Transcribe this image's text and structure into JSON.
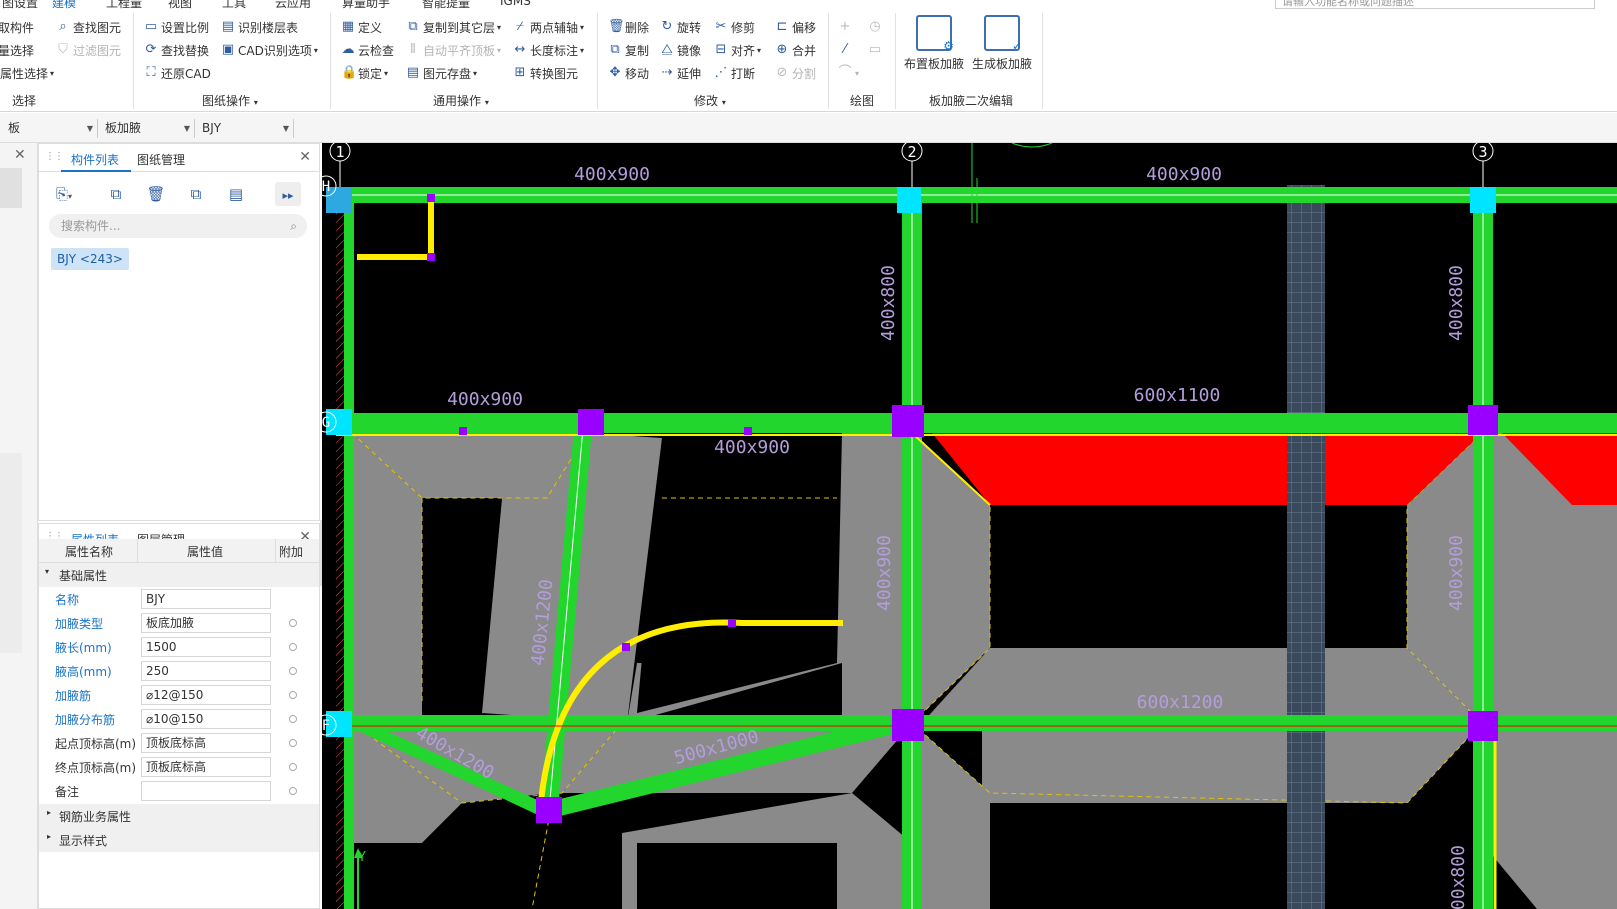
{
  "menubar": {
    "items": [
      "图设置",
      "建模",
      "工程量",
      "视图",
      "工具",
      "云应用",
      "算量助手",
      "智能提量",
      "IGMS"
    ],
    "active_index": 1
  },
  "search": {
    "placeholder": "请输入功能名称或问题描述"
  },
  "ribbon": {
    "select": {
      "items": [
        "拾取构件",
        "批量选择",
        "按属性选择"
      ],
      "group": "选择"
    },
    "find": {
      "find": "查找图元",
      "filter": "过滤图元"
    },
    "drawing": {
      "items": [
        "设置比例",
        "查找替换",
        "还原CAD",
        "识别楼层表",
        "CAD识别选项"
      ],
      "group": "图纸操作"
    },
    "general": {
      "items": [
        "定义",
        "云检查",
        "锁定",
        "复制到其它层",
        "自动平齐顶板",
        "图元存盘",
        "两点辅轴",
        "长度标注",
        "转换图元"
      ],
      "group": "通用操作"
    },
    "modify": {
      "items": [
        "删除",
        "复制",
        "移动",
        "旋转",
        "镜像",
        "延伸",
        "修剪",
        "对齐",
        "打断",
        "偏移",
        "合并",
        "分割"
      ],
      "group": "修改"
    },
    "draw": {
      "group": "绘图"
    },
    "haunch": {
      "place": "布置板加腋",
      "generate": "生成板加腋",
      "group": "板加腋二次编辑"
    }
  },
  "selectors": {
    "s1": "板",
    "s2": "板加腋",
    "s3": "BJY"
  },
  "component_panel": {
    "tab1": "构件列表",
    "tab2": "图纸管理",
    "search_placeholder": "搜索构件...",
    "tag": "BJY <243>"
  },
  "property_panel": {
    "tab1": "属性列表",
    "tab2": "图层管理",
    "headers": [
      "属性名称",
      "属性值",
      "附加"
    ],
    "section_basic": "基础属性",
    "rows": [
      {
        "name": "名称",
        "value": "BJY"
      },
      {
        "name": "加腋类型",
        "value": "板底加腋"
      },
      {
        "name": "腋长(mm)",
        "value": "1500"
      },
      {
        "name": "腋高(mm)",
        "value": "250"
      },
      {
        "name": "加腋筋",
        "value": "⌀12@150"
      },
      {
        "name": "加腋分布筋",
        "value": "⌀10@150"
      },
      {
        "name": "起点顶标高(m)",
        "value": "顶板底标高"
      },
      {
        "name": "终点顶标高(m)",
        "value": "顶板底标高"
      },
      {
        "name": "备注",
        "value": ""
      }
    ],
    "section_rebar": "钢筋业务属性",
    "section_display": "显示样式"
  },
  "canvas": {
    "axis_numbers": [
      "1",
      "2",
      "3"
    ],
    "axis_letters": [
      "H",
      "G",
      "F"
    ],
    "labels": [
      "400x900",
      "400x900",
      "400x900",
      "400x900",
      "400x800",
      "400x800",
      "600x1100",
      "400x900",
      "400x900",
      "400x1200",
      "400x1200",
      "500x1000",
      "600x1200",
      "400x800"
    ],
    "y_axis": "Y"
  },
  "colors": {
    "beam": "#22d62e",
    "column": "#9900ff",
    "haunch": "#8a8a8a",
    "yellow": "#ffee00",
    "red": "#ff0000",
    "label": "#b39ddb",
    "accent": "#1a73c7"
  }
}
